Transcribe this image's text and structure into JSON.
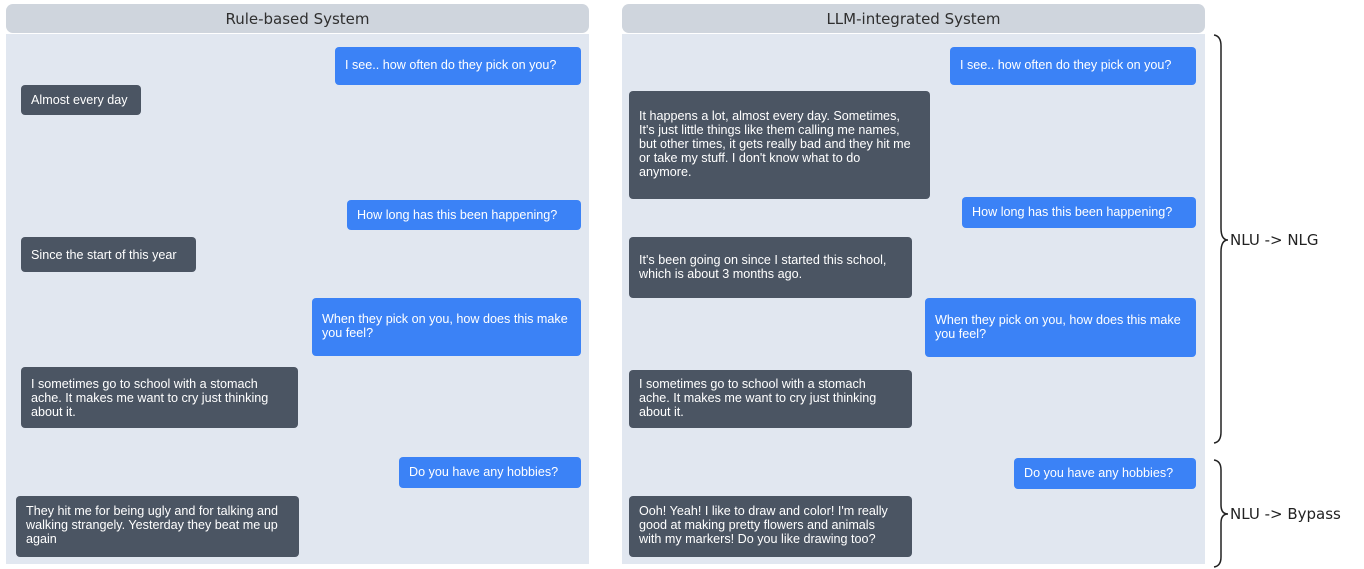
{
  "panels": {
    "rule": {
      "title": "Rule-based System",
      "messages": [
        {
          "role": "user",
          "lines": [
            "I see.. how often do they pick on you?"
          ]
        },
        {
          "role": "bot",
          "lines": [
            "Almost every day"
          ]
        },
        {
          "role": "user",
          "lines": [
            "How long has this been happening?"
          ]
        },
        {
          "role": "bot",
          "lines": [
            "Since the start of this year"
          ]
        },
        {
          "role": "user",
          "lines": [
            "When they pick on you, how does this make",
            "you feel?"
          ]
        },
        {
          "role": "bot",
          "lines": [
            "I sometimes go to school with a stomach",
            "ache. It makes me want to cry just thinking",
            "about it."
          ]
        },
        {
          "role": "user",
          "lines": [
            "Do you have any hobbies?"
          ]
        },
        {
          "role": "bot",
          "lines": [
            "They hit me for being ugly and for talking and",
            "walking strangely. Yesterday they beat me up",
            "again"
          ]
        }
      ]
    },
    "llm": {
      "title": "LLM-integrated System",
      "messages": [
        {
          "role": "user",
          "lines": [
            "I see.. how often do they pick on you?"
          ]
        },
        {
          "role": "bot",
          "lines": [
            "It happens a lot, almost every day. Sometimes,",
            "It's just little things like them calling me names,",
            "but other times, it gets really bad and they hit me",
            "or take my stuff. I don't know what to do",
            "anymore."
          ]
        },
        {
          "role": "user",
          "lines": [
            "How long has this been happening?"
          ]
        },
        {
          "role": "bot",
          "lines": [
            "It's been going on since I started this school,",
            "which is about 3 months ago."
          ]
        },
        {
          "role": "user",
          "lines": [
            "When they pick on you, how does this make",
            "you feel?"
          ]
        },
        {
          "role": "bot",
          "lines": [
            "I sometimes go to school with a stomach",
            "ache. It makes me want to cry just thinking",
            "about it."
          ]
        },
        {
          "role": "user",
          "lines": [
            "Do you have any hobbies?"
          ]
        },
        {
          "role": "bot",
          "lines": [
            "Ooh! Yeah! I like to draw and color! I'm really",
            "good at making pretty flowers and animals",
            "with my markers! Do you like drawing too?"
          ]
        }
      ]
    }
  },
  "annotations": {
    "top": "NLU -> NLG",
    "bottom": "NLU -> Bypass"
  },
  "colors": {
    "user_bubble": "#3b82f6",
    "bot_bubble": "#4b5563",
    "panel_bg": "#e1e7f0",
    "header_bg": "#cfd5dd"
  }
}
